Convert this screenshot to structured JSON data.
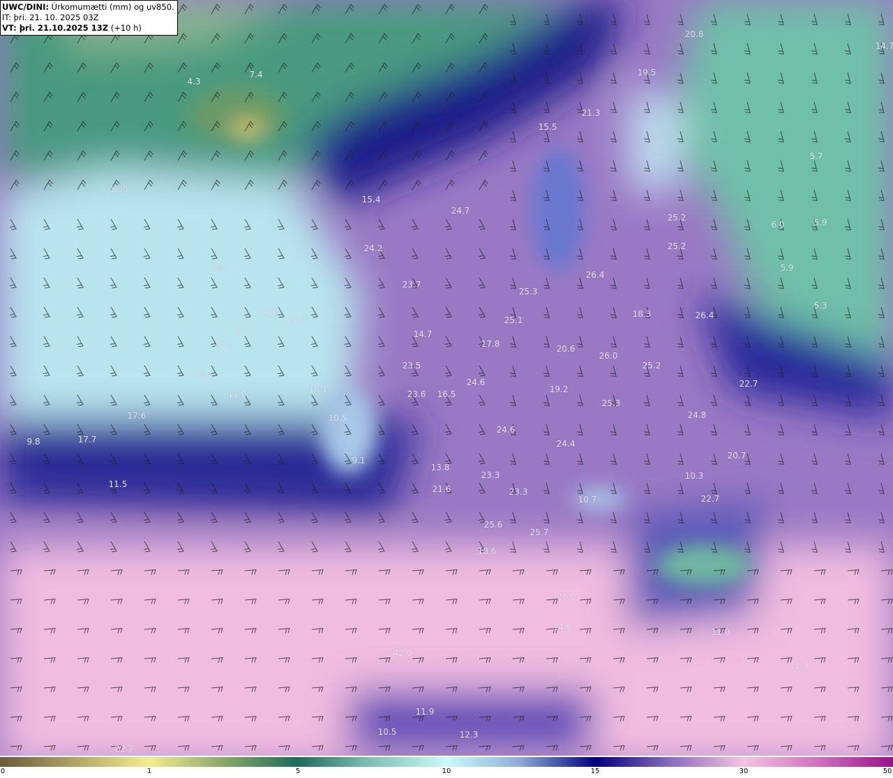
{
  "header": {
    "model": "UWC/DINI:",
    "field": "Úrkomumætti (mm) og uv850.",
    "initial_time": "IT: þri. 21. 10. 2025 03Z",
    "valid_time": "VT: þri. 21.10.2025 13Z",
    "lead": "(+10 h)"
  },
  "colorbar": {
    "ticks": [
      "0",
      "1",
      "5",
      "10",
      "15",
      "30",
      "50"
    ],
    "colors": [
      "#6b5a3a",
      "#f6ec8e",
      "#1e6b5a",
      "#c8fafa",
      "#00007e",
      "#f6c2e0",
      "#98108e"
    ]
  },
  "map_labels": [
    "4.3",
    "7.4",
    "15.0",
    "15.4",
    "24.7",
    "24.2",
    "16.7",
    "23.7",
    "15.8",
    "11.3",
    "11.1",
    "15.2",
    "14.7",
    "17.8",
    "23.5",
    "15.1",
    "16.1",
    "11.0",
    "23.6",
    "16.5",
    "24.6",
    "17.6",
    "10.5",
    "17.7",
    "24.6",
    "9.8",
    "9.1",
    "13.8",
    "23.3",
    "21.6",
    "23.3",
    "11.5",
    "20.8",
    "19.5",
    "21.3",
    "15.5",
    "14.7",
    "5.7",
    "6.0",
    "5.9",
    "5.9",
    "5.3",
    "25.2",
    "25.2",
    "26.4",
    "25.3",
    "18.3",
    "26.4",
    "25.1",
    "20.6",
    "26.0",
    "25.2",
    "22.7",
    "19.2",
    "25.3",
    "24.8",
    "24.4",
    "20.7",
    "10.3",
    "10.7",
    "22.7",
    "25.6",
    "25.7",
    "18.6",
    "14.5",
    "11.0",
    "42.0",
    "11.9",
    "11.9",
    "10.5",
    "12.3",
    "22.7",
    "28.0"
  ]
}
